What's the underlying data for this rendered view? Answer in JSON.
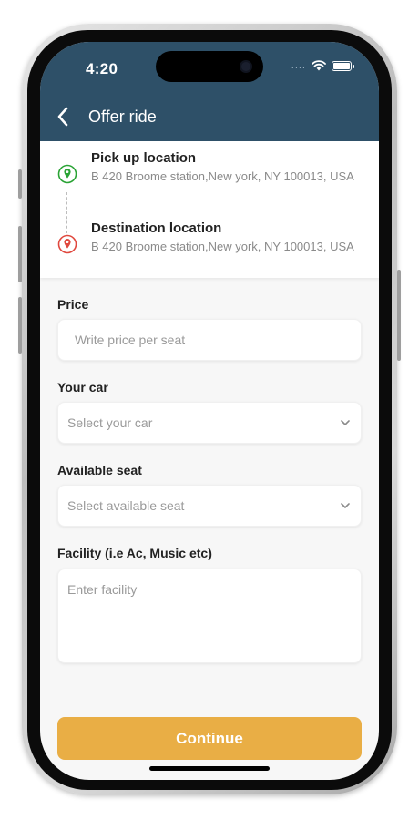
{
  "status_bar": {
    "time": "4:20",
    "signal": "....",
    "wifi_icon": "wifi-icon",
    "battery_icon": "battery-icon"
  },
  "header": {
    "title": "Offer ride",
    "back_icon": "chevron-left-icon",
    "background": "#2e5068"
  },
  "locations": {
    "pickup": {
      "title": "Pick up location",
      "address": "B 420 Broome station,New york, NY 100013, USA",
      "icon": "location-pin-icon",
      "color": "#2aa335"
    },
    "destination": {
      "title": "Destination location",
      "address": "B 420 Broome station,New york, NY 100013, USA",
      "icon": "location-pin-icon",
      "color": "#e0483e"
    }
  },
  "form": {
    "price": {
      "label": "Price",
      "placeholder": "Write price per seat",
      "value": ""
    },
    "car": {
      "label": "Your car",
      "placeholder": "Select your car",
      "icon": "chevron-down-icon"
    },
    "seat": {
      "label": "Available seat",
      "placeholder": "Select available seat",
      "icon": "chevron-down-icon"
    },
    "facility": {
      "label": "Facility (i.e Ac, Music etc)",
      "placeholder": "Enter facility",
      "value": ""
    }
  },
  "actions": {
    "continue_label": "Continue",
    "accent": "#e9ae45"
  }
}
